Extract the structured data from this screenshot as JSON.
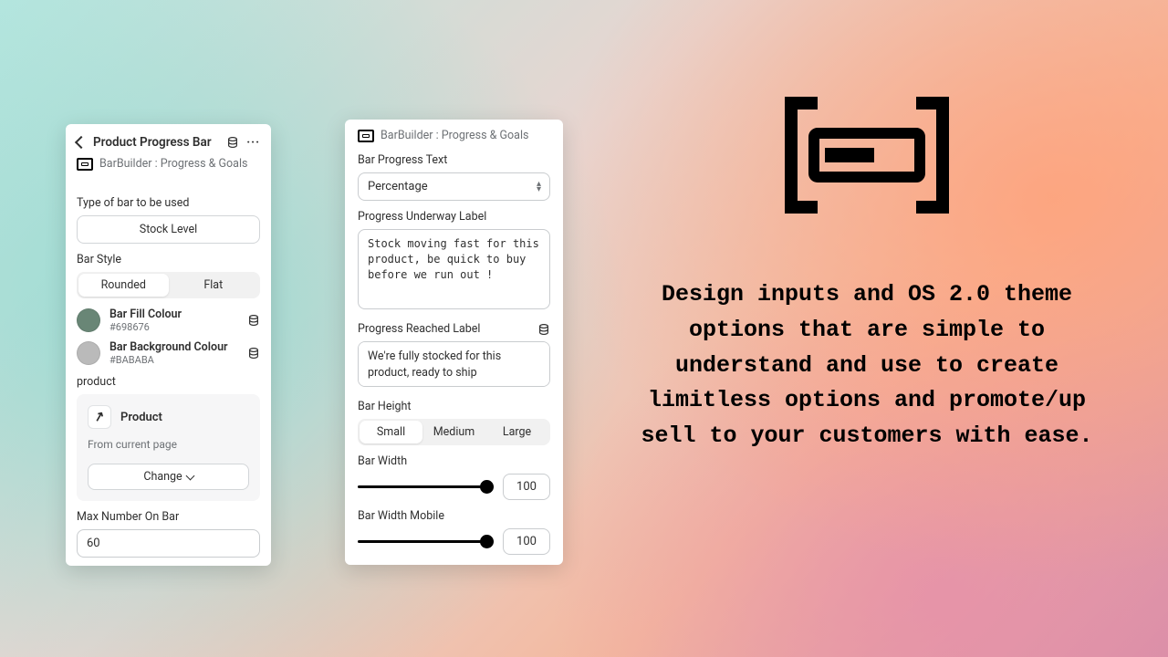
{
  "panel1": {
    "title": "Product Progress Bar",
    "app_line": "BarBuilder : Progress & Goals",
    "type_label": "Type of bar to be used",
    "type_value": "Stock Level",
    "bar_style_label": "Bar Style",
    "style_options": {
      "rounded": "Rounded",
      "flat": "Flat"
    },
    "fill_colour": {
      "name": "Bar Fill Colour",
      "hex": "#698676"
    },
    "bg_colour": {
      "name": "Bar Background Colour",
      "hex": "#BABABA"
    },
    "product_label": "product",
    "product_name": "Product",
    "product_sub": "From current page",
    "change_label": "Change",
    "max_label": "Max Number On Bar",
    "max_value": "60"
  },
  "panel2": {
    "app_line": "BarBuilder : Progress & Goals",
    "progress_text_label": "Bar Progress Text",
    "progress_text_value": "Percentage",
    "underway_label": "Progress Underway Label",
    "underway_value": "Stock moving fast for this product, be quick to buy before we run out !",
    "reached_label": "Progress Reached Label",
    "reached_value": "We're fully stocked for this product, ready to ship",
    "bar_height_label": "Bar Height",
    "height_options": {
      "small": "Small",
      "medium": "Medium",
      "large": "Large"
    },
    "bar_width_label": "Bar Width",
    "bar_width_value": "100",
    "bar_width_mobile_label": "Bar Width Mobile",
    "bar_width_mobile_value": "100"
  },
  "hero": {
    "text": "Design inputs and OS 2.0 theme options that are simple to understand and use to create limitless options and promote/up sell to your customers with ease."
  }
}
